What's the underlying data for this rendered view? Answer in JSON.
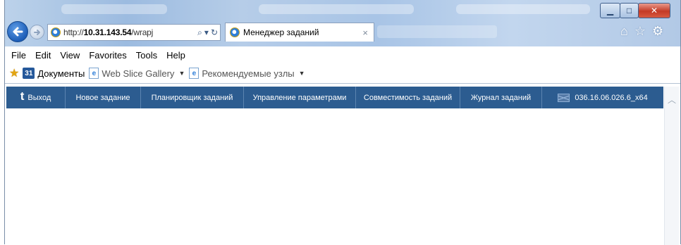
{
  "browser": {
    "address": {
      "url_prefix": "http://",
      "url_host": "10.31.143.54",
      "url_rest": "/wrapj"
    },
    "tab": {
      "title": "Менеджер заданий",
      "close": "×"
    }
  },
  "menu": {
    "items": [
      "File",
      "Edit",
      "View",
      "Favorites",
      "Tools",
      "Help"
    ]
  },
  "favorites": {
    "calendar_badge": "31",
    "documents": "Документы",
    "web_slice": "Web Slice Gallery",
    "recommended": "Рекомендуемые узлы"
  },
  "appnav": {
    "exit": "Выход",
    "new_task": "Новое задание",
    "scheduler": "Планировщик заданий",
    "params": "Управление параметрами",
    "compat": "Совместимость заданий",
    "journal": "Журнал заданий",
    "version": "036.16.06.026.6_x64"
  },
  "icons": {
    "back": "back-arrow-icon",
    "forward": "forward-arrow-icon",
    "home": "home-icon",
    "favorites": "star-icon",
    "settings": "gear-icon",
    "exit": "exit-icon",
    "version": "mail-icon"
  },
  "colors": {
    "nav_background": "#2c5c90",
    "nav_text": "#ffffff",
    "close_button": "#c43a26"
  }
}
